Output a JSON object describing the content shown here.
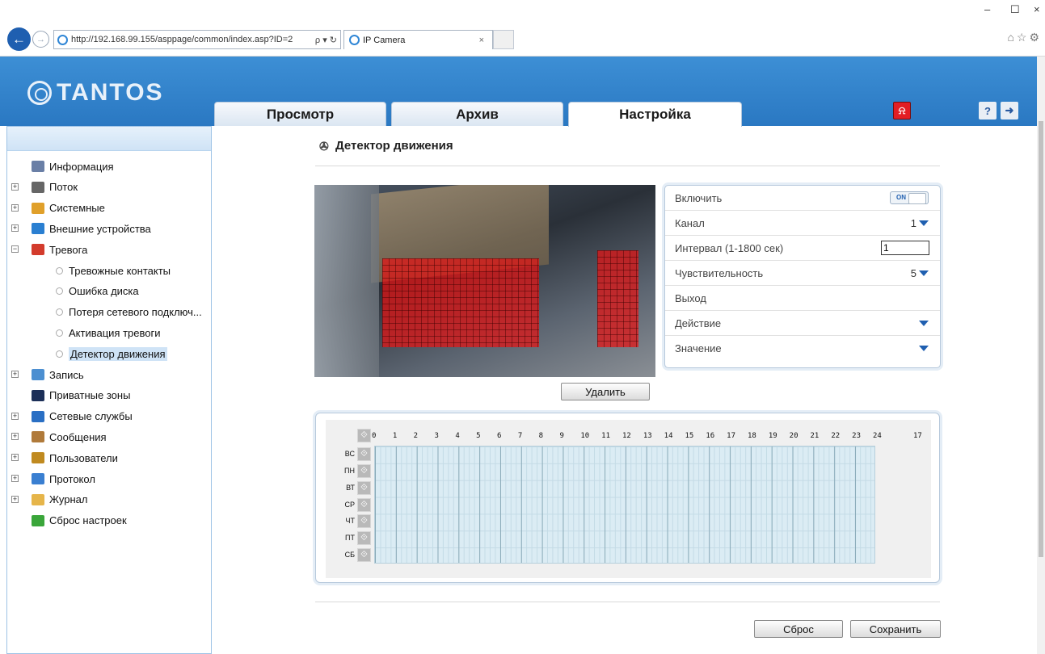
{
  "browser": {
    "url": "http://192.168.99.155/asppage/common/index.asp?ID=2",
    "url_tools": "ρ ▾ ↻",
    "tab_title": "IP Camera",
    "tab_close": "×",
    "win_min": "–",
    "win_max": "☐",
    "win_close": "×",
    "right_icons": "⌂☆⚙"
  },
  "brand": {
    "logo_text": "TANTOS"
  },
  "main_tabs": [
    {
      "label": "Просмотр"
    },
    {
      "label": "Архив"
    },
    {
      "label": "Настройка",
      "active": true
    }
  ],
  "header_buttons": {
    "alarm_icon": "alarm-bell-icon",
    "help_icon": "help-icon",
    "logout_icon": "logout-icon"
  },
  "sidebar": {
    "items": [
      {
        "label": "Информация",
        "level": 0,
        "expandable": false,
        "icon_color": "#6a7fa6"
      },
      {
        "label": "Поток",
        "level": 0,
        "expandable": true,
        "icon_color": "#666666"
      },
      {
        "label": "Системные",
        "level": 0,
        "expandable": true,
        "icon_color": "#e0a02a"
      },
      {
        "label": "Внешние устройства",
        "level": 0,
        "expandable": true,
        "icon_color": "#2a7fd1"
      },
      {
        "label": "Тревога",
        "level": 0,
        "expandable": true,
        "expanded": true,
        "icon_color": "#d33b2c"
      },
      {
        "label": "Тревожные контакты",
        "level": 1
      },
      {
        "label": "Ошибка диска",
        "level": 1
      },
      {
        "label": "Потеря сетевого подключ...",
        "level": 1
      },
      {
        "label": "Активация тревоги",
        "level": 1
      },
      {
        "label": "Детектор движения",
        "level": 1,
        "selected": true
      },
      {
        "label": "Запись",
        "level": 0,
        "expandable": true,
        "icon_color": "#4c8fd1"
      },
      {
        "label": "Приватные зоны",
        "level": 0,
        "expandable": false,
        "icon_color": "#1c2f58"
      },
      {
        "label": "Сетевые службы",
        "level": 0,
        "expandable": true,
        "icon_color": "#2a6fc4"
      },
      {
        "label": "Сообщения",
        "level": 0,
        "expandable": true,
        "icon_color": "#b07a3a"
      },
      {
        "label": "Пользователи",
        "level": 0,
        "expandable": true,
        "icon_color": "#c08a20"
      },
      {
        "label": "Протокол",
        "level": 0,
        "expandable": true,
        "icon_color": "#3a7fd1"
      },
      {
        "label": "Журнал",
        "level": 0,
        "expandable": true,
        "icon_color": "#e6b54a"
      },
      {
        "label": "Сброс настроек",
        "level": 0,
        "expandable": false,
        "icon_color": "#3aa63a"
      }
    ]
  },
  "page": {
    "title": "Детектор движения",
    "settings": {
      "enable_label": "Включить",
      "enable_value": "ON",
      "channel_label": "Канал",
      "channel_value": "1",
      "interval_label": "Интервал (1-1800 сек)",
      "interval_value": "1",
      "sensitivity_label": "Чувствительность",
      "sensitivity_value": "5",
      "output_label": "Выход",
      "action_label": "Действие",
      "value_label": "Значение"
    },
    "delete_label": "Удалить",
    "reset_label": "Сброс",
    "save_label": "Сохранить"
  },
  "schedule": {
    "hours": [
      "0",
      "1",
      "2",
      "3",
      "4",
      "5",
      "6",
      "7",
      "8",
      "9",
      "10",
      "11",
      "12",
      "13",
      "14",
      "15",
      "16",
      "17",
      "18",
      "19",
      "20",
      "21",
      "22",
      "23",
      "24"
    ],
    "end_label": "17",
    "days": [
      "ВС",
      "ПН",
      "ВТ",
      "СР",
      "ЧТ",
      "ПТ",
      "СБ"
    ]
  }
}
